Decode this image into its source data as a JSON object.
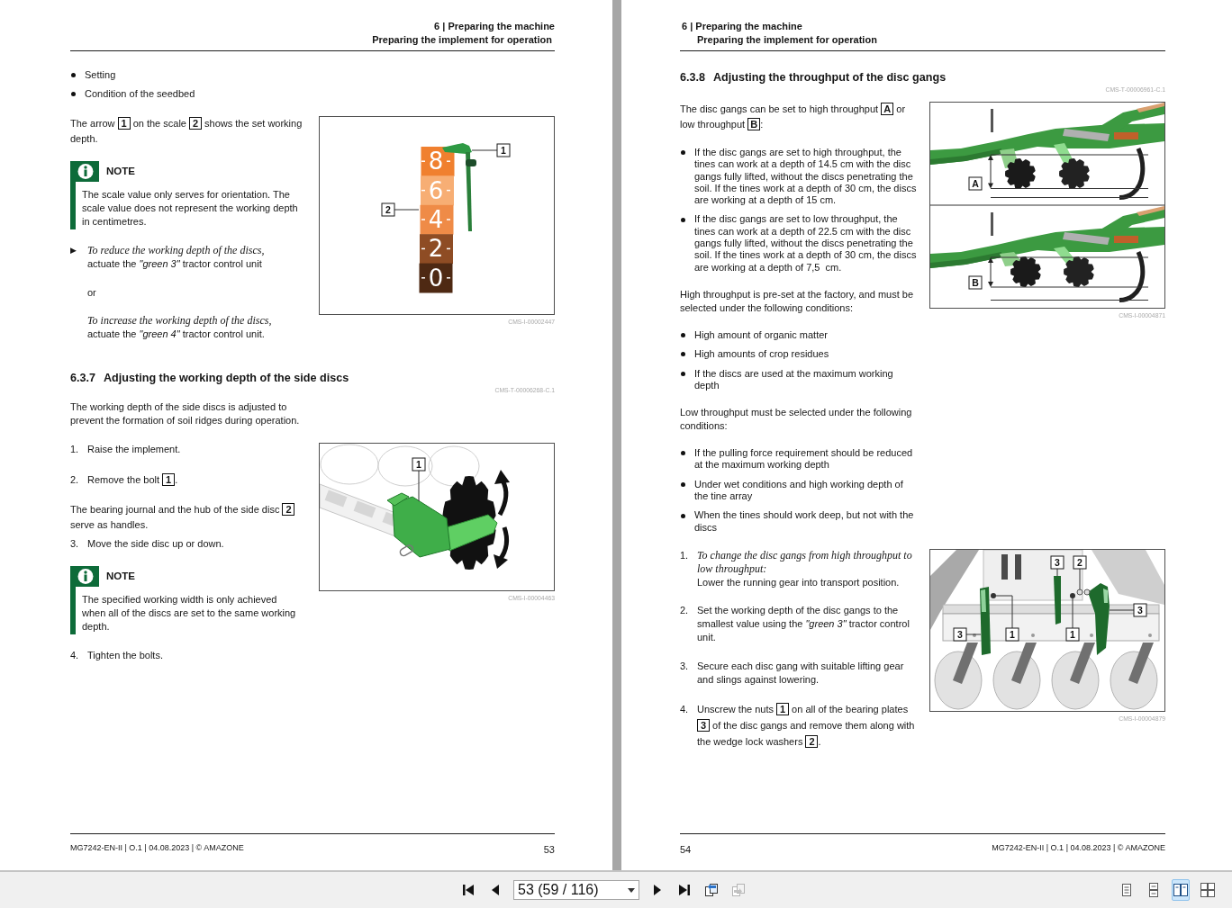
{
  "pages": [
    {
      "header": {
        "chapter": "6 | Preparing the machine",
        "section": "Preparing the implement for operation"
      },
      "sections": [
        {
          "blocks": [
            {
              "kind": "bullet",
              "text": "Setting"
            },
            {
              "kind": "bullet",
              "text": "Condition of the seedbed"
            }
          ]
        },
        {
          "blocks": [
            {
              "kind": "paragraph",
              "parts": [
                "The arrow ",
                {
                  "callout": "1"
                },
                " on the scale ",
                {
                  "callout": "2"
                },
                " shows the set working depth."
              ]
            },
            {
              "kind": "note",
              "title": "NOTE",
              "text": "The scale value only serves for orientation. The scale value does not represent the working depth in centimetres."
            },
            {
              "kind": "instruction",
              "marker": "▶",
              "lead": "To reduce the working depth of the discs,",
              "text": "actuate the *\"green 3\"* tractor control unit"
            },
            {
              "kind": "aside",
              "text": "or"
            },
            {
              "kind": "instruction",
              "lead": "To increase the working depth of the discs,",
              "text": "actuate the *\"green 4\"* tractor control unit."
            }
          ],
          "figure": {
            "kind": "depth_scale",
            "scale_labels": [
              "8",
              "6",
              "4",
              "2",
              "0"
            ],
            "callouts": [
              "1",
              "2"
            ],
            "code": "CMS-I-00002447"
          }
        },
        {
          "blocks": [
            {
              "kind": "heading",
              "number": "6.3.7",
              "title": "Adjusting the working depth of the side discs",
              "code": "CMS-T-00006268-C.1"
            },
            {
              "kind": "paragraph",
              "parts": [
                "The working depth of the side discs is adjusted to prevent the formation of soil ridges during operation."
              ]
            }
          ]
        },
        {
          "blocks": [
            {
              "kind": "step",
              "number": "1.",
              "parts": [
                "Raise the implement."
              ]
            },
            {
              "kind": "step",
              "number": "2.",
              "parts": [
                "Remove the bolt ",
                {
                  "callout": "1"
                },
                "."
              ]
            },
            {
              "kind": "paragraph",
              "parts": [
                "The bearing journal and the hub of the side disc ",
                {
                  "callout": "2"
                },
                " serve as handles."
              ]
            },
            {
              "kind": "step",
              "number": "3.",
              "parts": [
                "Move the side disc up or down."
              ]
            },
            {
              "kind": "note",
              "title": "NOTE",
              "text": "The specified working width is only achieved when all of the discs are set to the same working depth."
            },
            {
              "kind": "step",
              "number": "4.",
              "parts": [
                "Tighten the bolts."
              ]
            }
          ],
          "figure": {
            "kind": "side_disc",
            "callouts": [
              "1"
            ],
            "code": "CMS-I-00004463"
          }
        }
      ],
      "footer": {
        "document": "MG7242-EN-II | O.1 | 04.08.2023 | © AMAZONE",
        "page_number": "53"
      }
    },
    {
      "header": {
        "chapter": "6 | Preparing the machine",
        "section": "Preparing the implement for operation"
      },
      "sections": [
        {
          "blocks": [
            {
              "kind": "heading",
              "number": "6.3.8",
              "title": "Adjusting the throughput of the disc gangs",
              "code": "CMS-T-00006961-C.1"
            }
          ]
        },
        {
          "blocks": [
            {
              "kind": "paragraph",
              "parts": [
                "The disc gangs can be set to high throughput ",
                {
                  "callout": "A"
                },
                " or low throughput ",
                {
                  "callout": "B"
                },
                ":"
              ]
            },
            {
              "kind": "bullet",
              "text": "If the disc gangs are set to high throughput, the tines can work at a depth of 14.5 cm with the disc gangs fully lifted, without the discs penetrating the soil. If the tines work at a depth of 30 cm, the discs are working at a depth of 15 cm."
            },
            {
              "kind": "bullet",
              "text": "If the disc gangs are set to low throughput, the tines can work at a depth of 22.5 cm with the disc gangs fully lifted, without the discs penetrating the soil. If the tines work at a depth of 30 cm, the discs are working at a depth of 7,5  cm."
            },
            {
              "kind": "paragraph",
              "parts": [
                "High throughput is pre-set at the factory, and must be selected under the following conditions:"
              ]
            },
            {
              "kind": "bullet",
              "text": "High amount of organic matter"
            },
            {
              "kind": "bullet",
              "text": "High amounts of crop residues"
            },
            {
              "kind": "bullet",
              "text": "If the discs are used at the maximum working depth"
            },
            {
              "kind": "paragraph",
              "parts": [
                "Low throughput must be selected under the following conditions:"
              ]
            },
            {
              "kind": "bullet",
              "text": "If the pulling force requirement should be reduced at the maximum working depth"
            },
            {
              "kind": "bullet",
              "text": "Under wet conditions and high working depth of the tine array"
            },
            {
              "kind": "bullet",
              "text": "When the tines should work deep, but not with the discs"
            }
          ],
          "figure": {
            "kind": "throughput_views",
            "callouts": [
              "A",
              "B"
            ],
            "code": "CMS-I-00004871"
          }
        },
        {
          "blocks": [
            {
              "kind": "step",
              "number": "1.",
              "lead": "To change the disc gangs from high throughput to low throughput:",
              "parts": [
                "Lower the running gear into transport position."
              ]
            },
            {
              "kind": "step",
              "number": "2.",
              "parts": [
                "Set the working depth of the disc gangs to the smallest value using the *\"green 3\"* tractor control unit."
              ]
            },
            {
              "kind": "step",
              "number": "3.",
              "parts": [
                "Secure each disc gang with suitable lifting gear and slings against lowering."
              ]
            },
            {
              "kind": "step",
              "number": "4.",
              "parts": [
                "Unscrew the nuts ",
                {
                  "callout": "1"
                },
                " on all of the bearing plates ",
                {
                  "callout": "3"
                },
                " of the disc gangs and remove them along with the wedge lock washers ",
                {
                  "callout": "2"
                },
                "."
              ]
            }
          ],
          "figure": {
            "kind": "bearing_plates",
            "callouts": [
              "3",
              "2",
              "3",
              "3",
              "1",
              "1"
            ],
            "code": "CMS-I-00004879"
          }
        }
      ],
      "footer": {
        "document": "MG7242-EN-II | O.1 | 04.08.2023 | © AMAZONE",
        "page_number": "54"
      }
    }
  ],
  "toolbar": {
    "controls": [
      {
        "kind": "first",
        "disabled": false
      },
      {
        "kind": "previous",
        "disabled": false
      },
      {
        "kind": "page_field",
        "value": "53 (59 / 116)",
        "disabled": false
      },
      {
        "kind": "next",
        "disabled": false
      },
      {
        "kind": "last",
        "disabled": false
      },
      {
        "kind": "view_back",
        "disabled": false
      },
      {
        "kind": "view_forward",
        "disabled": true
      }
    ],
    "view_modes": [
      {
        "kind": "single",
        "selected": false
      },
      {
        "kind": "continuous",
        "selected": false
      },
      {
        "kind": "facing",
        "selected": true
      },
      {
        "kind": "facing_continuous",
        "selected": false
      }
    ]
  }
}
